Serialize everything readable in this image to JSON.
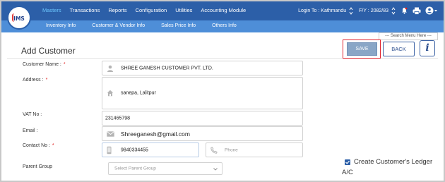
{
  "brand": {
    "logo_text": "IMS"
  },
  "nav": {
    "items": [
      {
        "label": "Masters",
        "active": true
      },
      {
        "label": "Transactions",
        "active": false
      },
      {
        "label": "Reports",
        "active": false
      },
      {
        "label": "Configuration",
        "active": false
      },
      {
        "label": "Utilities",
        "active": false
      },
      {
        "label": "Accounting Module",
        "active": false
      }
    ],
    "login_text": "Login To : Kathmandu",
    "fy_text": "F/Y :  2082/83"
  },
  "subnav": {
    "items": [
      "Inventory Info",
      "Customer & Vendor Info",
      "Sales Price Info",
      "Others Info"
    ]
  },
  "search_menu": {
    "placeholder": "--- Search Menu Here ---"
  },
  "page": {
    "title": "Add Customer"
  },
  "buttons": {
    "save": "SAVE",
    "back": "BACK",
    "info": "i"
  },
  "form": {
    "customer_name": {
      "label": "Customer Name :",
      "required": "*",
      "value": "SHREE GANESH CUSTOMER PVT. LTD."
    },
    "address": {
      "label": "Address :",
      "required": "*",
      "value": "sanepa, Lalitpur"
    },
    "vat_no": {
      "label": "VAT No :",
      "value": "231465798"
    },
    "email": {
      "label": "Email :",
      "value": "Shreeganesh@gmail.com"
    },
    "contact_no": {
      "label": "Contact No :",
      "required": "*",
      "mobile_value": "9840334455",
      "phone_placeholder": "Phone"
    },
    "parent_group": {
      "label": "Parent Group",
      "placeholder": "Select Parent Group"
    },
    "ledger_checkbox": {
      "label_line1": "Create Customer's Ledger",
      "label_line2": "A/C",
      "checked": true
    }
  },
  "colors": {
    "topbar": "#2c5fa8",
    "subbar": "#4e8ed8",
    "active_nav": "#6cc7ff",
    "save_button": "#8aa6c6",
    "highlight_border": "#e0242f",
    "required": "#e02020"
  },
  "icons": {
    "user": "user-icon",
    "home": "home-icon",
    "email": "envelope-icon",
    "mobile": "mobile-icon",
    "phone": "phone-icon",
    "bell": "bell-icon",
    "printer": "printer-icon",
    "account": "account-icon",
    "chevron": "chevron-down-icon"
  }
}
